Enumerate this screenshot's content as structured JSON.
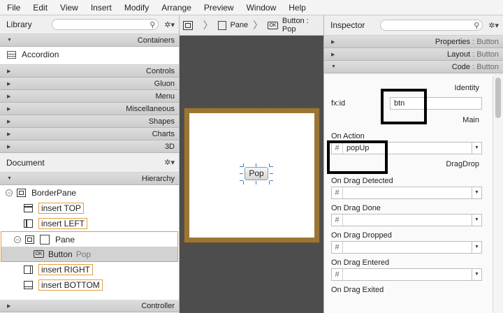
{
  "menu": [
    "File",
    "Edit",
    "View",
    "Insert",
    "Modify",
    "Arrange",
    "Preview",
    "Window",
    "Help"
  ],
  "library": {
    "title": "Library",
    "sections": [
      "Containers",
      "Controls",
      "Gluon",
      "Menu",
      "Miscellaneous",
      "Shapes",
      "Charts",
      "3D"
    ],
    "first_item": "Accordion"
  },
  "document": {
    "title": "Document",
    "hierarchy_label": "Hierarchy",
    "tree": {
      "border_pane": "BorderPane",
      "insert_top": "insert TOP",
      "insert_left": "insert LEFT",
      "pane": "Pane",
      "button": "Button",
      "button_text": "Pop",
      "insert_right": "insert RIGHT",
      "insert_bottom": "insert BOTTOM"
    },
    "controller_label": "Controller"
  },
  "breadcrumb": {
    "pane": "Pane",
    "button": "Button : Pop",
    "ok_icon_text": "OK"
  },
  "canvas": {
    "button_label": "Pop"
  },
  "inspector": {
    "title": "Inspector",
    "sections": {
      "properties": "Properties",
      "layout": "Layout",
      "code": "Code",
      "suffix": ": Button"
    },
    "identity_label": "Identity",
    "fxid_label": "fx:id",
    "fxid_value": "btn",
    "main_label": "Main",
    "on_action_label": "On Action",
    "on_action_value": "popUp",
    "dragdrop_label": "DragDrop",
    "events": [
      "On Drag Detected",
      "On Drag Done",
      "On Drag Dropped",
      "On Drag Entered",
      "On Drag Exited"
    ],
    "hash": "#"
  },
  "colors": {
    "highlight_border": "#e0a040",
    "scene_frame": "#9a7536",
    "canvas_bg": "#4a4a4a"
  }
}
